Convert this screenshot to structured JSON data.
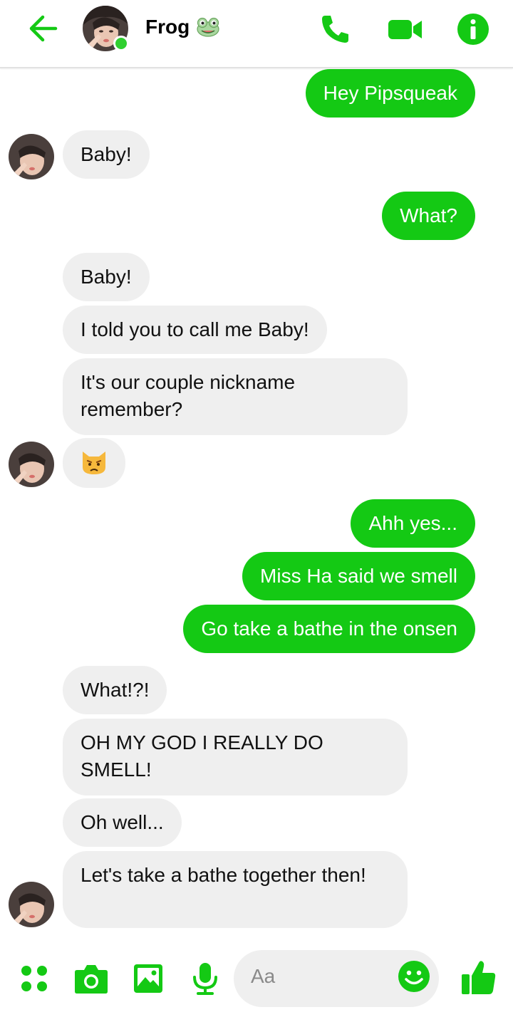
{
  "header": {
    "contact_name": "Frog",
    "name_emoji": "frog-face-icon",
    "online": true,
    "icons": [
      "back-arrow-icon",
      "phone-icon",
      "video-camera-icon",
      "info-icon"
    ]
  },
  "messages": [
    {
      "dir": "out",
      "text": "Hey Pipsqueak"
    },
    {
      "dir": "in",
      "text": "Baby!",
      "avatar": true
    },
    {
      "dir": "out",
      "text": "What?"
    },
    {
      "dir": "in",
      "text": "Baby!"
    },
    {
      "dir": "in",
      "text": "I told you to call me Baby!"
    },
    {
      "dir": "in",
      "text": "It's our couple nickname remember?"
    },
    {
      "dir": "in",
      "emoji": "pouting-cat-icon",
      "avatar": true
    },
    {
      "dir": "out",
      "text": "Ahh yes..."
    },
    {
      "dir": "out",
      "text": "Miss Ha said we smell"
    },
    {
      "dir": "out",
      "text": "Go take a bathe in the onsen"
    },
    {
      "dir": "in",
      "text": "What!?!"
    },
    {
      "dir": "in",
      "text": "OH MY GOD I REALLY DO SMELL!"
    },
    {
      "dir": "in",
      "text": "Oh well..."
    },
    {
      "dir": "in",
      "text": "Let's take a bathe together then!",
      "avatar": true
    }
  ],
  "composer": {
    "placeholder": "Aa",
    "icons": [
      "apps-icon",
      "camera-icon",
      "gallery-icon",
      "microphone-icon",
      "emoji-smile-icon",
      "thumbs-up-icon"
    ]
  },
  "colors": {
    "accent": "#14c914",
    "incoming_bubble": "#efefef",
    "online": "#2fcf2f"
  }
}
